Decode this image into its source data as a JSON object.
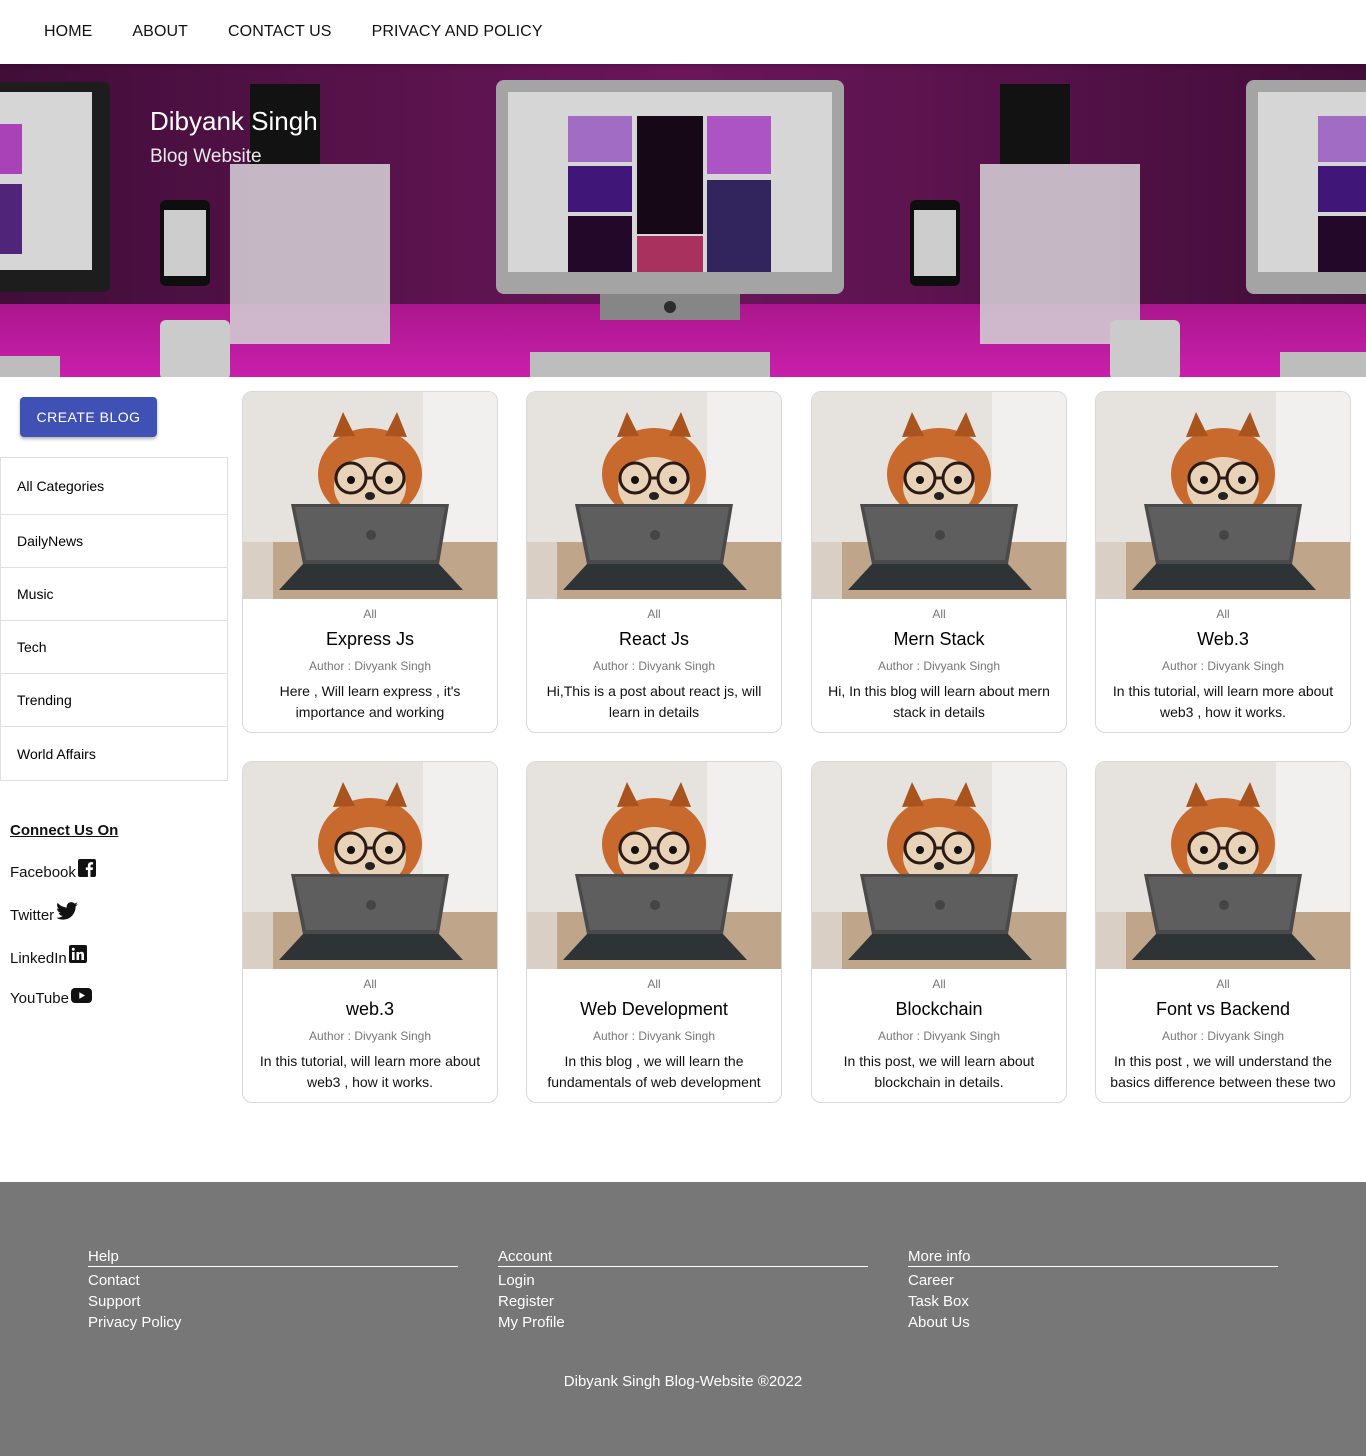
{
  "nav": {
    "items": [
      "HOME",
      "ABOUT",
      "CONTACT US",
      "PRIVACY AND POLICY"
    ]
  },
  "banner": {
    "title": "Dibyank Singh",
    "subtitle": "Blog Website"
  },
  "sidebar": {
    "create_label": "CREATE BLOG",
    "categories": [
      "All Categories",
      "DailyNews",
      "Music",
      "Tech",
      "Trending",
      "World Affairs"
    ],
    "connect_title": "Connect Us On",
    "socials": [
      {
        "label": "Facebook",
        "icon": "facebook-icon"
      },
      {
        "label": "Twitter",
        "icon": "twitter-icon"
      },
      {
        "label": "LinkedIn",
        "icon": "linkedin-icon"
      },
      {
        "label": "YouTube",
        "icon": "youtube-icon"
      }
    ]
  },
  "posts": [
    {
      "category": "All",
      "title": "Express Js",
      "author": "Author : Divyank Singh",
      "desc": "Here , Will learn express , it's importance and working"
    },
    {
      "category": "All",
      "title": "React Js",
      "author": "Author : Divyank Singh",
      "desc": "Hi,This is a post about react js, will learn in details"
    },
    {
      "category": "All",
      "title": "Mern Stack",
      "author": "Author : Divyank Singh",
      "desc": "Hi, In this blog will learn about mern stack in details"
    },
    {
      "category": "All",
      "title": "Web.3",
      "author": "Author : Divyank Singh",
      "desc": "In this tutorial, will learn more about web3 , how it works."
    },
    {
      "category": "All",
      "title": "web.3",
      "author": "Author : Divyank Singh",
      "desc": "In this tutorial, will learn more about web3 , how it works."
    },
    {
      "category": "All",
      "title": "Web Development",
      "author": "Author : Divyank Singh",
      "desc": "In this blog , we will learn the fundamentals of web development"
    },
    {
      "category": "All",
      "title": "Blockchain",
      "author": "Author : Divyank Singh",
      "desc": "In this post, we will learn about blockchain in details."
    },
    {
      "category": "All",
      "title": "Font vs Backend",
      "author": "Author : Divyank Singh",
      "desc": "In this post , we will understand the basics difference between these two"
    }
  ],
  "footer": {
    "columns": [
      {
        "heading": "Help",
        "links": [
          "Contact",
          "Support",
          "Privacy Policy"
        ]
      },
      {
        "heading": "Account",
        "links": [
          "Login",
          "Register",
          "My Profile"
        ]
      },
      {
        "heading": "More info",
        "links": [
          "Career",
          "Task Box",
          "About Us"
        ]
      }
    ],
    "copyright": "Dibyank Singh Blog-Website ®2022"
  },
  "colors": {
    "primary_button": "#3f51b5",
    "footer_bg": "#777777",
    "banner_accent": "#d61fb3"
  }
}
